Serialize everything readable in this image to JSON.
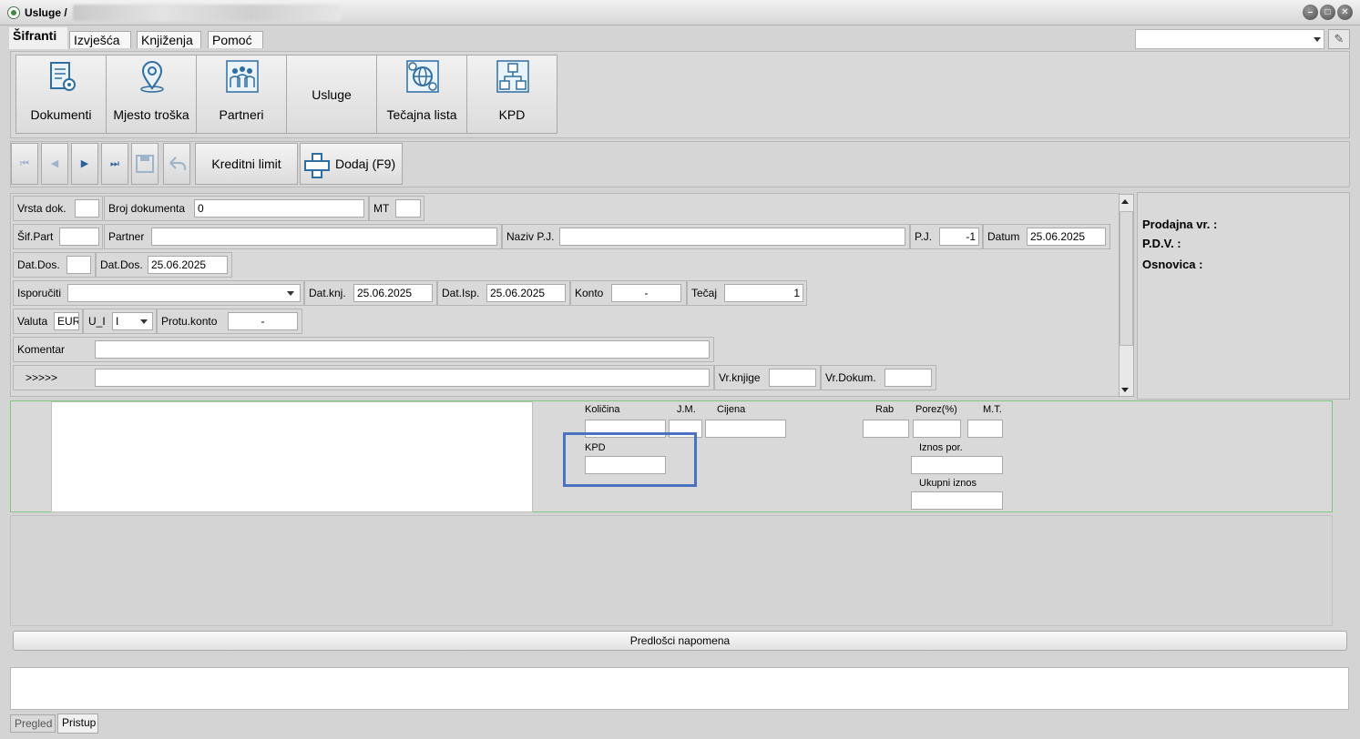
{
  "window": {
    "title": "Usluge /",
    "buttons": [
      "minimize",
      "maximize",
      "close"
    ]
  },
  "menu": {
    "tabs": [
      "Šifranti",
      "Izvješća",
      "Knjiženja",
      "Pomoć"
    ],
    "active": "Šifranti"
  },
  "ribbon": {
    "buttons": [
      {
        "label": "Dokumenti",
        "icon": "document-gear-icon"
      },
      {
        "label": "Mjesto troška",
        "icon": "location-pin-icon"
      },
      {
        "label": "Partneri",
        "icon": "people-group-icon"
      },
      {
        "label": "Usluge",
        "icon": ""
      },
      {
        "label": "Tečajna lista",
        "icon": "globe-currency-icon"
      },
      {
        "label": "KPD",
        "icon": "hierarchy-icon"
      }
    ]
  },
  "toolbar": {
    "first_symbol": "⏮",
    "prev_symbol": "◀",
    "next_symbol": "▶",
    "last_symbol": "⏭",
    "kreditni_limit": "Kreditni limit",
    "dodaj": "Dodaj (F9)"
  },
  "form": {
    "vrsta_dok_label": "Vrsta dok.",
    "vrsta_dok_value": "",
    "broj_dokumenta_label": "Broj dokumenta",
    "broj_dokumenta_value": "0",
    "mt_label": "MT",
    "mt_value": "",
    "sif_part_label": "Šif.Part",
    "sif_part_value": "",
    "partner_label": "Partner",
    "partner_value": "",
    "naziv_pj_label": "Naziv P.J.",
    "naziv_pj_value": "",
    "pj_label": "P.J.",
    "pj_value": "-1",
    "datum_label": "Datum",
    "datum_value": "25.06.2025",
    "dat_dos_label1": "Dat.Dos.",
    "dat_dos_value1": "",
    "dat_dos_label2": "Dat.Dos.",
    "dat_dos_value2": "25.06.2025",
    "isporuciti_label": "Isporučiti",
    "isporuciti_value": "",
    "dat_knj_label": "Dat.knj.",
    "dat_knj_value": "25.06.2025",
    "dat_isp_label": "Dat.Isp.",
    "dat_isp_value": "25.06.2025",
    "konto_label": "Konto",
    "konto_value": "-",
    "tecaj_label": "Tečaj",
    "tecaj_value": "1",
    "valuta_label": "Valuta",
    "valuta_value": "EUR",
    "u_i_label": "U_I",
    "u_i_value": "I",
    "protu_konto_label": "Protu.konto",
    "protu_konto_value": "-",
    "komentar_label": "Komentar",
    "komentar_value": "",
    "arrows_label": ">>>>>",
    "arrows_value": "",
    "vr_knjige_label": "Vr.knjige",
    "vr_knjige_value": "",
    "vr_dokum_label": "Vr.Dokum.",
    "vr_dokum_value": ""
  },
  "summary": {
    "prodajna_vr": "Prodajna vr. :",
    "pdv": "P.D.V. :",
    "osnovica": "Osnovica :"
  },
  "detail": {
    "kolicina": "Količina",
    "jm": "J.M.",
    "cijena": "Cijena",
    "rab": "Rab",
    "porez": "Porez(%)",
    "mt": "M.T.",
    "kpd": "KPD",
    "iznos_por": "Iznos por.",
    "ukupni_iznos": "Ukupni iznos"
  },
  "predlosci": "Predlošci napomena",
  "bottom_tabs": [
    "Pregled",
    "Pristup"
  ],
  "bottom_active": "Pristup",
  "colors": {
    "highlight": "#4a72c0",
    "accent_blue": "#2f6ea3",
    "detail_border": "#7fc97f"
  }
}
